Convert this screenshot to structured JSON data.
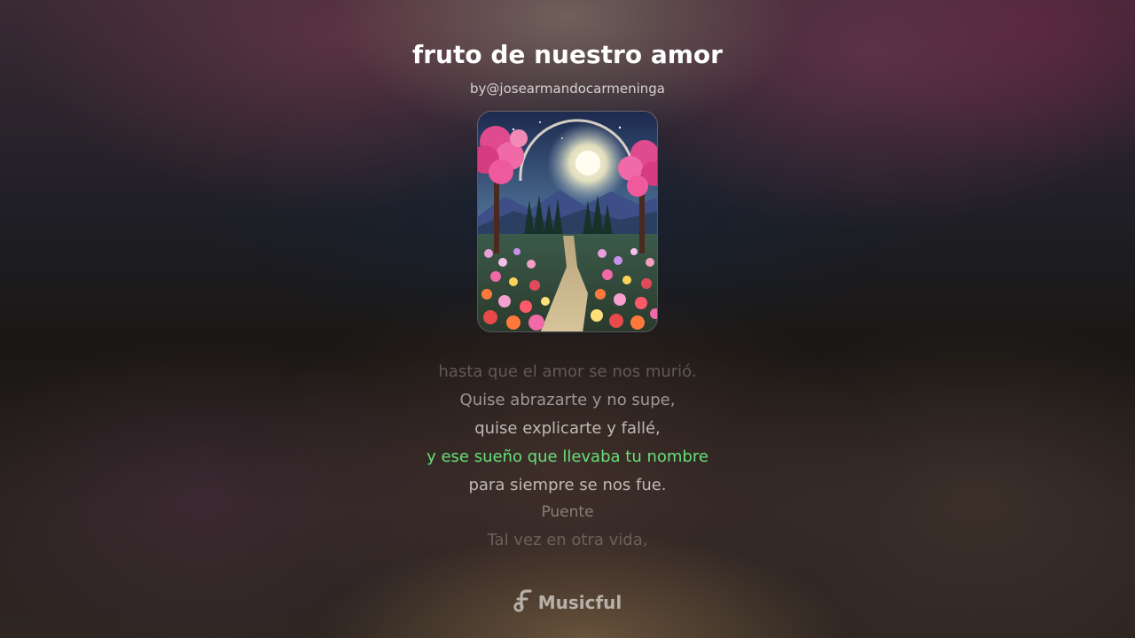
{
  "song": {
    "title": "fruto de nuestro amor",
    "byline": "by@josearmandocarmeninga"
  },
  "lyrics": [
    {
      "text": "hasta que el amor se nos murió.",
      "state": "far"
    },
    {
      "text": "Quise abrazarte y no supe,",
      "state": "near"
    },
    {
      "text": "quise explicarte y fallé,",
      "state": "near"
    },
    {
      "text": "y ese sueño que llevaba tu nombre",
      "state": "active"
    },
    {
      "text": "para siempre se nos fue.",
      "state": "near"
    },
    {
      "text": "Puente",
      "state": "section"
    },
    {
      "text": "Tal vez en otra vida,",
      "state": "far"
    }
  ],
  "brand": {
    "name": "Musicful",
    "icon": "musicful-logo-icon"
  },
  "colors": {
    "active_lyric": "#66e07a"
  }
}
